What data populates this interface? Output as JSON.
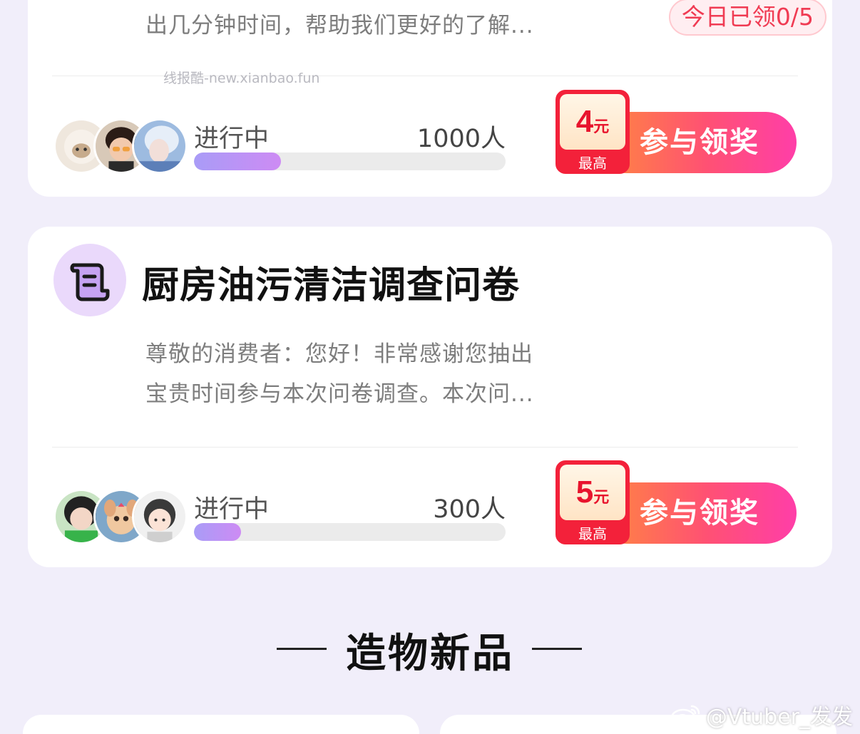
{
  "cards": [
    {
      "badge": "今日已领0/5",
      "desc_lines": [
        "出几分钟时间，帮助我们更好的了解..."
      ],
      "watermark": "线报酷-new.xianbao.fun",
      "status": "进行中",
      "participants": "1000人",
      "progress": 0.28,
      "reward": {
        "amount": "4",
        "unit": "元",
        "caption": "最高",
        "button": "参与领奖"
      }
    },
    {
      "title": "厨房油污清洁调查问卷",
      "desc_lines": [
        "尊敬的消费者：您好！非常感谢您抽出",
        "宝贵时间参与本次问卷调查。本次问..."
      ],
      "status": "进行中",
      "participants": "300人",
      "progress": 0.15,
      "reward": {
        "amount": "5",
        "unit": "元",
        "caption": "最高",
        "button": "参与领奖"
      }
    }
  ],
  "section": {
    "title": "造物新品"
  },
  "weibo_watermark": "@Vtuber_发发",
  "colors": {
    "accent": "#f3213a",
    "progress": "#b596f5",
    "background": "#f1eefa"
  },
  "icons": [
    "scroll-document-icon",
    "weibo-logo-icon"
  ]
}
